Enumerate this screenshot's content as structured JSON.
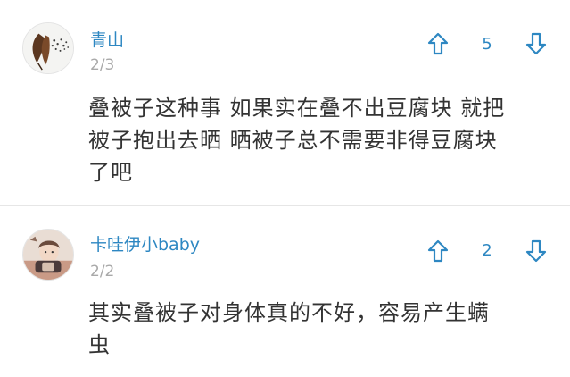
{
  "comments": [
    {
      "username": "青山",
      "date": "2/3",
      "vote_count": "5",
      "text": "叠被子这种事 如果实在叠不出豆腐块 就把\n被子抱出去晒 晒被子总不需要非得豆腐块\n了吧",
      "icons": {
        "avatar": "leaf-feathers-avatar",
        "upvote": "arrow-up-icon",
        "downvote": "arrow-down-icon"
      }
    },
    {
      "username": "卡哇伊小baby",
      "date": "2/2",
      "vote_count": "2",
      "text": "其实叠被子对身体真的不好，容易产生螨\n虫",
      "icons": {
        "avatar": "illustrated-figure-avatar",
        "upvote": "arrow-up-icon",
        "downvote": "arrow-down-icon"
      }
    }
  ],
  "colors": {
    "username": "#2d87c2",
    "vote_arrow": "#2d87c2",
    "date": "#a9a9a9",
    "body_text": "#333333",
    "divider": "#e6e6e6"
  }
}
